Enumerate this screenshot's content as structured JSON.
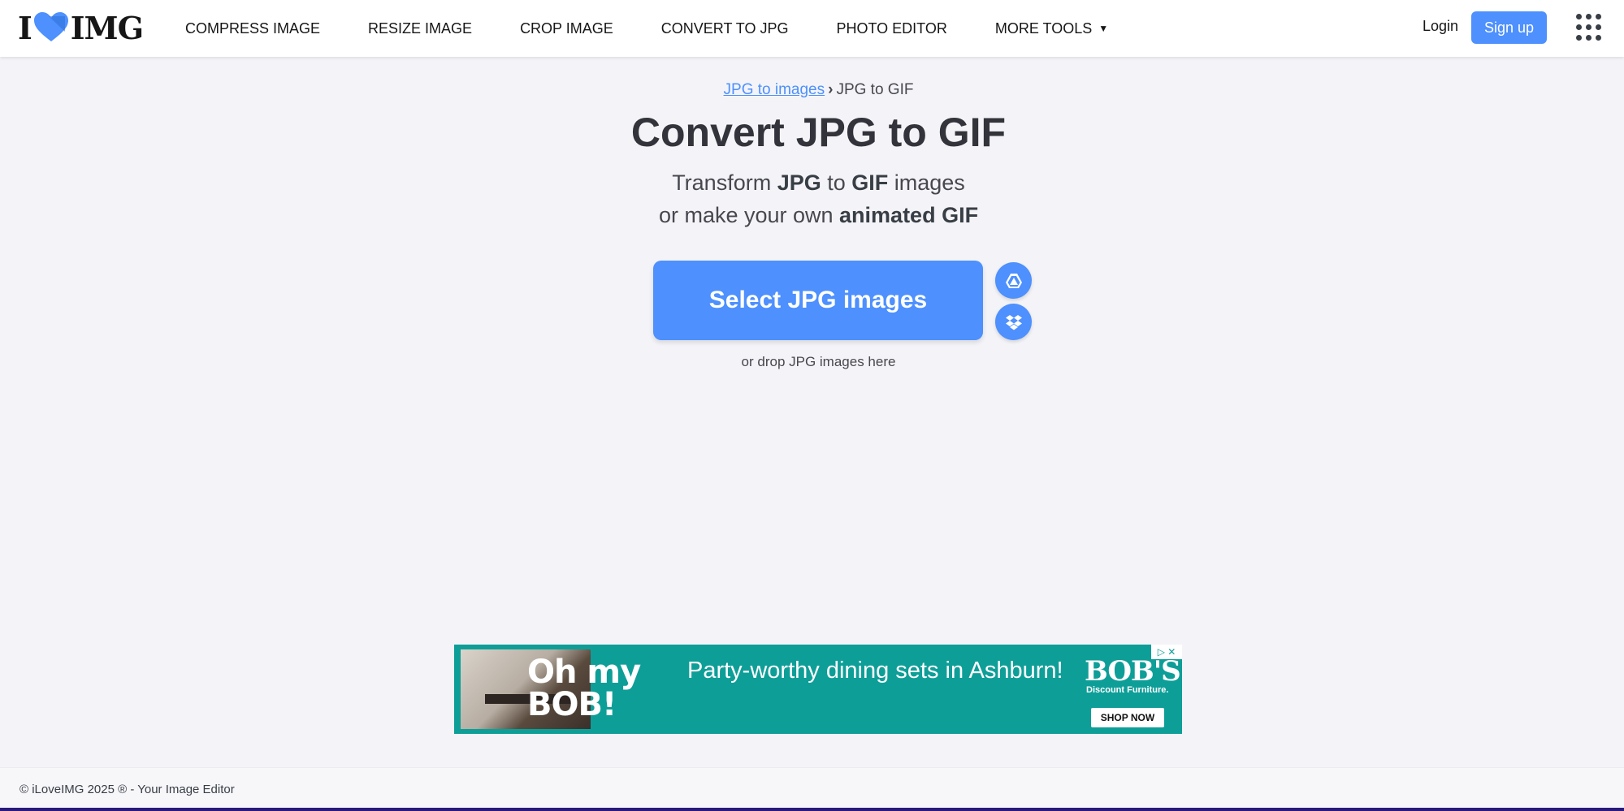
{
  "header": {
    "logo": {
      "left": "I",
      "right": "IMG"
    },
    "nav": [
      {
        "label": "COMPRESS IMAGE"
      },
      {
        "label": "RESIZE IMAGE"
      },
      {
        "label": "CROP IMAGE"
      },
      {
        "label": "CONVERT TO JPG"
      },
      {
        "label": "PHOTO EDITOR"
      },
      {
        "label": "MORE TOOLS"
      }
    ],
    "login": "Login",
    "signup": "Sign up"
  },
  "main": {
    "breadcrumb": {
      "parent": "JPG to images",
      "separator": "›",
      "current": "JPG to GIF"
    },
    "title": "Convert JPG to GIF",
    "subtitle": {
      "l1_a": "Transform ",
      "l1_b": "JPG",
      "l1_c": " to ",
      "l1_d": "GIF",
      "l1_e": " images",
      "l2_a": "or make your own ",
      "l2_b": "animated GIF"
    },
    "select_button": "Select JPG images",
    "drop_hint": "or drop JPG images here",
    "cloud_icons": [
      "google-drive-icon",
      "dropbox-icon"
    ]
  },
  "ad": {
    "brand_line1": "Oh my",
    "brand_line2": "BOB!",
    "headline": "Party-worthy dining sets in Ashburn!",
    "brand": "BOB'S",
    "brand_sub": "Discount Furniture.",
    "cta": "SHOP NOW",
    "choices": "▷ ✕"
  },
  "footer": {
    "text": "© iLoveIMG 2025 ® - Your Image Editor"
  },
  "colors": {
    "accent": "#4d90fe",
    "ad_bg": "#0e9e98",
    "page_bg": "#f4f4f8"
  }
}
